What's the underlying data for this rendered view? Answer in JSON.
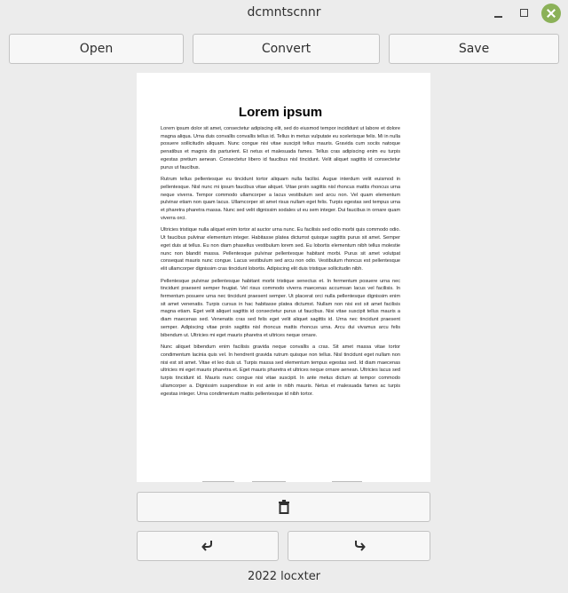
{
  "window": {
    "title": "dcmntscnnr"
  },
  "toolbar": {
    "open_label": "Open",
    "convert_label": "Convert",
    "save_label": "Save"
  },
  "preview": {
    "heading": "Lorem ipsum",
    "paragraphs": [
      "Lorem ipsum dolor sit amet, consectetur adipiscing elit, sed do eiusmod tempor incididunt ut labore et dolore magna aliqua. Urna duis convallis convallis tellus id. Tellus in metus vulputate eu scelerisque felis. Mi in nulla posuere sollicitudin aliquam. Nunc congue nisi vitae suscipit tellus mauris. Gravida cum sociis natoque penatibus et magnis dis parturient. Et netus et malesuada fames. Tellus cras adipiscing enim eu turpis egestas pretium aenean. Consectetur libero id faucibus nisl tincidunt. Velit aliquet sagittis id consectetur purus ut faucibus.",
      "Rutrum tellus pellentesque eu tincidunt tortor aliquam nulla facilisi. Augue interdum velit euismod in pellentesque. Nisl nunc mi ipsum faucibus vitae aliquet. Vitae proin sagittis nisl rhoncus mattis rhoncus urna neque viverra. Tempor commodo ullamcorper a lacus vestibulum sed arcu non. Vel quam elementum pulvinar etiam non quam lacus. Ullamcorper sit amet risus nullam eget felis. Turpis egestas sed tempus urna et pharetra pharetra massa. Nunc sed velit dignissim sodales ut eu sem integer. Dui faucibus in ornare quam viverra orci.",
      "Ultricies tristique nulla aliquet enim tortor at auctor urna nunc. Eu facilisis sed odio morbi quis commodo odio. Ut faucibus pulvinar elementum integer. Habitasse platea dictumst quisque sagittis purus sit amet. Semper eget duis at tellus. Eu non diam phasellus vestibulum lorem sed. Eu lobortis elementum nibh tellus molestie nunc non blandit massa. Pellentesque pulvinar pellentesque habitant morbi. Purus sit amet volutpat consequat mauris nunc congue. Lacus vestibulum sed arcu non odio. Vestibulum rhoncus est pellentesque elit ullamcorper dignissim cras tincidunt lobortis. Adipiscing elit duis tristique sollicitudin nibh.",
      "Pellentesque pulvinar pellentesque habitant morbi tristique senectus et. In fermentum posuere urna nec tincidunt praesent semper feugiat. Vel risus commodo viverra maecenas accumsan lacus vel facilisis. In fermentum posuere urna nec tincidunt praesent semper. Ut placerat orci nulla pellentesque dignissim enim sit amet venenatis. Turpis cursus in hac habitasse platea dictumst. Nullam non nisi est sit amet facilisis magna etiam. Eget velit aliquet sagittis id consectetur purus ut faucibus. Nisi vitae suscipit tellus mauris a diam maecenas sed. Venenatis cras sed felis eget velit aliquet sagittis id. Urna nec tincidunt praesent semper. Adipiscing vitae proin sagittis nisl rhoncus mattis rhoncus urna. Arcu dui vivamus arcu felis bibendum ut. Ultricies mi eget mauris pharetra et ultrices neque ornare.",
      "Nunc aliquet bibendum enim facilisis gravida neque convallis a cras. Sit amet massa vitae tortor condimentum lacinia quis vel. In hendrerit gravida rutrum quisque non tellus. Nisl tincidunt eget nullam non nisi est sit amet. Vitae et leo duis ut. Turpis massa sed elementum tempus egestas sed. Id diam maecenas ultricies mi eget mauris pharetra et. Eget mauris pharetra et ultrices neque ornare aenean. Ultricies lacus sed turpis tincidunt id. Mauris nunc congue nisi vitae suscipit. In ante metus dictum at tempor commodo ullamcorper a. Dignissim suspendisse in est ante in nibh mauris. Netus et malesuada fames ac turpis egestas integer. Urna condimentum mattis pellentesque id nibh tortor."
    ]
  },
  "actions": {
    "delete_icon": "trash-icon",
    "rotate_left_icon": "rotate-left-icon",
    "rotate_right_icon": "rotate-right-icon"
  },
  "footer": {
    "text": "2022 locxter"
  },
  "colors": {
    "window_bg": "#ececec",
    "button_bg": "#f7f7f7",
    "close_button": "#8bb158"
  }
}
